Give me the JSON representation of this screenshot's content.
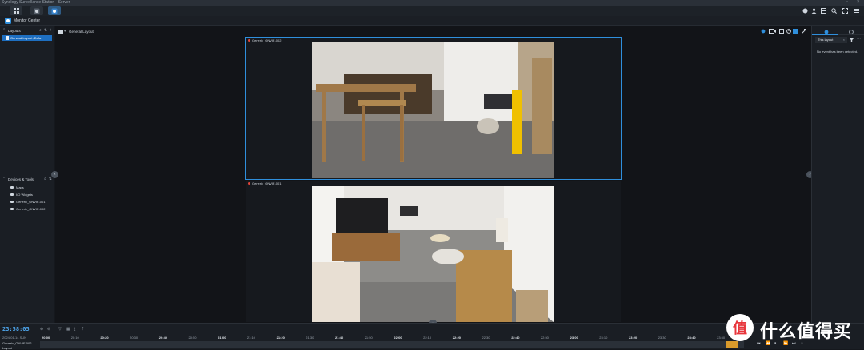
{
  "window": {
    "title": "Synology Surveillance Station - Server"
  },
  "app": {
    "title": "Monitor Center"
  },
  "layouts": {
    "header": "Layouts",
    "items": [
      "General Layout (Defa"
    ]
  },
  "devices": {
    "header": "Devices & Tools",
    "items": [
      {
        "label": "Maps",
        "icon": "map-icon"
      },
      {
        "label": "I/O Widgets",
        "icon": "io-widget-icon"
      },
      {
        "label": "Generic_ONVIF-001",
        "icon": "camera-icon"
      },
      {
        "label": "Generic_ONVIF-002",
        "icon": "camera-icon"
      }
    ]
  },
  "main": {
    "layout_label": "General Layout"
  },
  "cameras": [
    {
      "name": "Generic_ONVIF-002",
      "selected": true
    },
    {
      "name": "Generic_ONVIF-001",
      "selected": false
    }
  ],
  "events": {
    "filter_label": "This layout",
    "empty_text": "No event has been detected."
  },
  "timeline": {
    "current_time": "23:58:05",
    "date": "2024-01-14 SUN",
    "camera_name": "Generic_ONVIF-002",
    "layout_label": "Layout",
    "ticks": [
      "20:00",
      "20:10",
      "20:20",
      "20:30",
      "20:40",
      "20:50",
      "21:00",
      "21:10",
      "21:20",
      "21:30",
      "21:40",
      "21:50",
      "22:00",
      "22:10",
      "22:20",
      "22:30",
      "22:40",
      "22:50",
      "23:00",
      "23:10",
      "23:20",
      "23:30",
      "23:40",
      "23:50"
    ]
  },
  "watermark": {
    "text": "什么值得买",
    "logo_char": "值"
  },
  "colors": {
    "accent": "#1e6fc1",
    "selection": "#2f8fdc",
    "recording_dot": "#e0453a",
    "timeline_marker": "#d99a2b"
  }
}
